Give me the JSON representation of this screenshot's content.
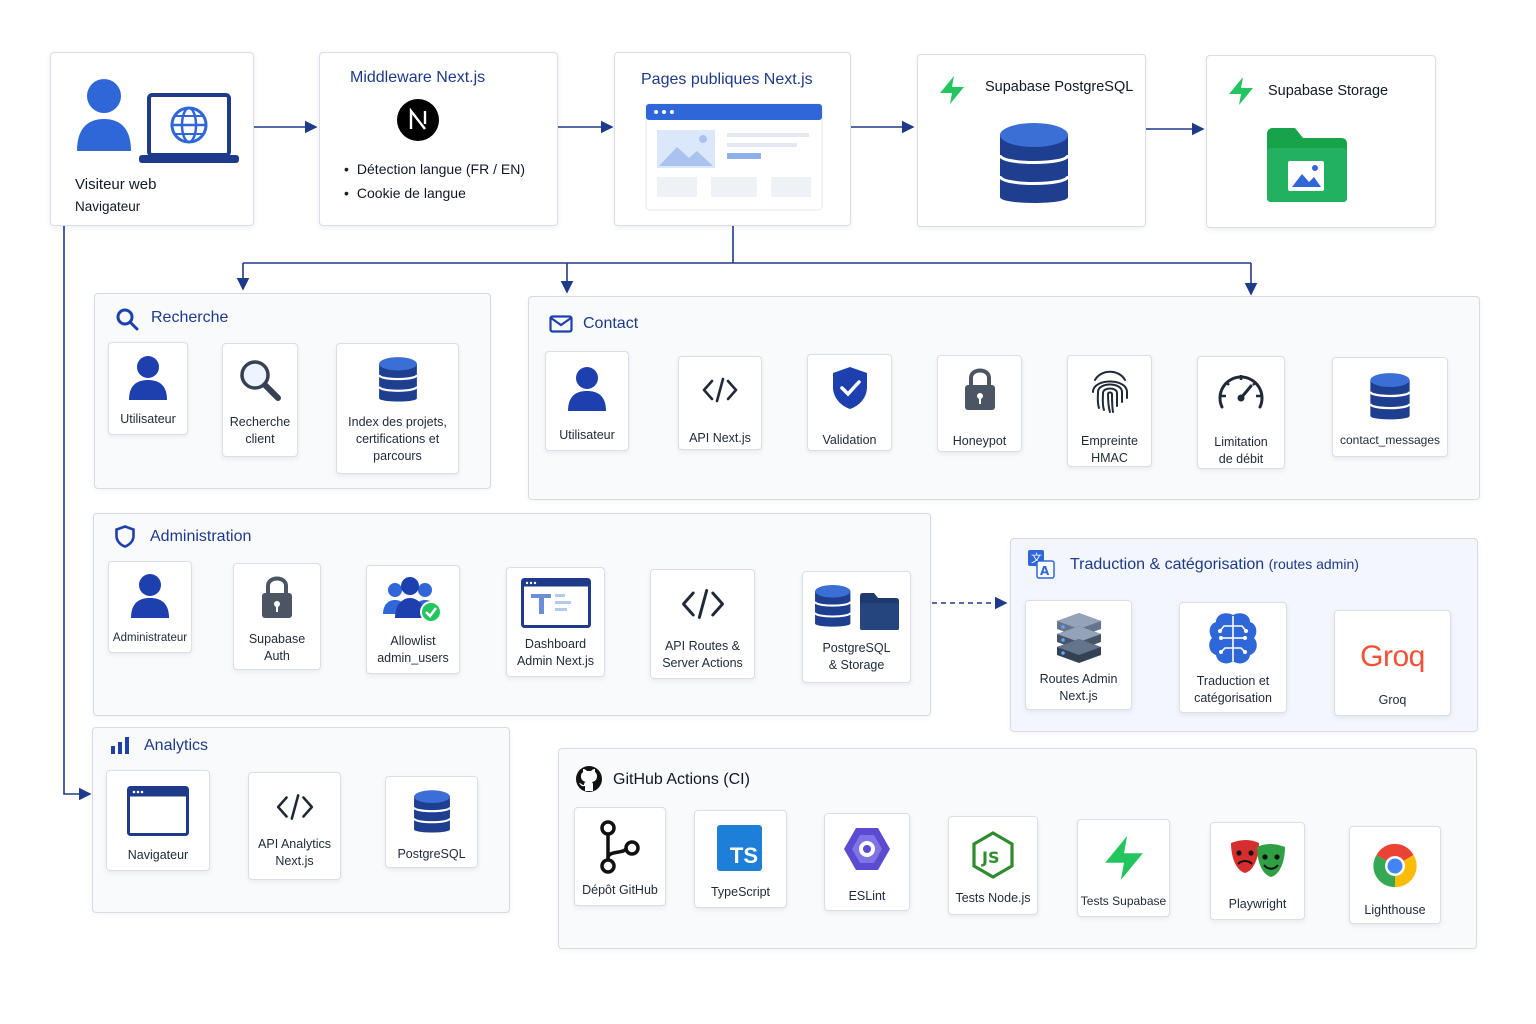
{
  "top": {
    "visitor": {
      "title": "Visiteur web",
      "subtitle": "Navigateur"
    },
    "middleware": {
      "title": "Middleware Next.js",
      "bullet1": "Détection langue (FR / EN)",
      "bullet2": "Cookie de langue"
    },
    "pages": {
      "title": "Pages publiques Next.js"
    },
    "postgres": {
      "title": "Supabase PostgreSQL"
    },
    "storage": {
      "title": "Supabase Storage"
    }
  },
  "search": {
    "title": "Recherche",
    "nodes": [
      "Utilisateur",
      "Recherche\nclient",
      "Index des projets,\ncertifications et\nparcours"
    ]
  },
  "contact": {
    "title": "Contact",
    "nodes": [
      "Utilisateur",
      "API Next.js",
      "Validation",
      "Honeypot",
      "Empreinte\nHMAC",
      "Limitation\nde débit",
      "contact_messages"
    ]
  },
  "admin": {
    "title": "Administration",
    "nodes": [
      "Administrateur",
      "Supabase\nAuth",
      "Allowlist\nadmin_users",
      "Dashboard\nAdmin Next.js",
      "API Routes &\nServer Actions",
      "PostgreSQL\n& Storage"
    ]
  },
  "translation": {
    "title": "Traduction & catégorisation",
    "subtitle": "(routes admin)",
    "nodes": [
      "Routes Admin\nNext.js",
      "Traduction et\ncatégorisation",
      "Groq"
    ],
    "logo_text": "Groq"
  },
  "analytics": {
    "title": "Analytics",
    "nodes": [
      "Navigateur",
      "API Analytics\nNext.js",
      "PostgreSQL"
    ]
  },
  "ci": {
    "title": "GitHub Actions (CI)",
    "nodes": [
      "Dépôt GitHub",
      "TypeScript",
      "ESLint",
      "Tests Node.js",
      "Tests Supabase",
      "Playwright",
      "Lighthouse"
    ],
    "ts_badge": "TS"
  },
  "colors": {
    "primary": "#1e40af",
    "title_blue": "#1e3a8a",
    "supabase_green": "#22c55e",
    "groq_orange": "#f55036",
    "arrow": "#1e3a8a"
  }
}
